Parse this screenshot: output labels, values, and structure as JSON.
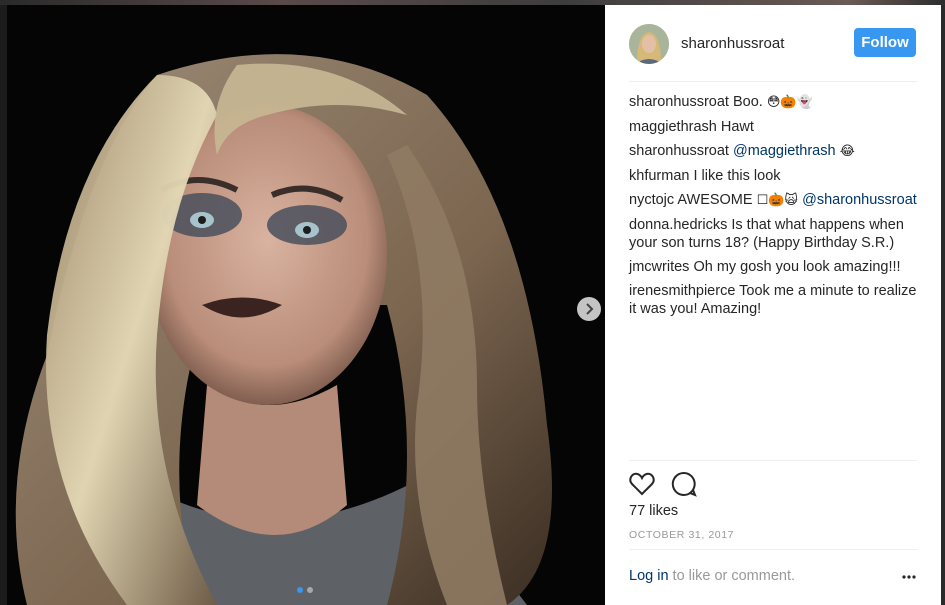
{
  "post": {
    "author": "sharonhussroat",
    "follow_label": "Follow",
    "likes": "77 likes",
    "date": "OCTOBER 31, 2017",
    "login_link": "Log in",
    "login_suffix": " to like or comment.",
    "more_label": "•••"
  },
  "comments": [
    {
      "user": "sharonhussroat",
      "text": " Boo. ",
      "emoji": "😳🎃👻"
    },
    {
      "user": "maggiethrash",
      "text": " Hawt"
    },
    {
      "user": "sharonhussroat",
      "text": " ",
      "mention": "@maggiethrash",
      "emoji": " 😂"
    },
    {
      "user": "khfurman",
      "text": " I like this look"
    },
    {
      "user": "nyctojc",
      "text": " AWESOME ",
      "emoji": "☐🎃🙀 ",
      "mention": "@sharonhussroat"
    },
    {
      "user": "donna.hedricks",
      "text": " Is that what happens when your son turns 18? (Happy Birthday S.R.)"
    },
    {
      "user": "jmcwrites",
      "text": " Oh my gosh you look amazing!!!"
    },
    {
      "user": "irenesmithpierce",
      "text": " Took me a minute to realize it was you! Amazing!"
    }
  ],
  "icons": {
    "next": "chevron-right-icon",
    "like": "heart-icon",
    "comment": "speech-bubble-icon"
  },
  "colors": {
    "follow_button": "#3897f0",
    "mention": "#003569",
    "muted": "#999999"
  }
}
